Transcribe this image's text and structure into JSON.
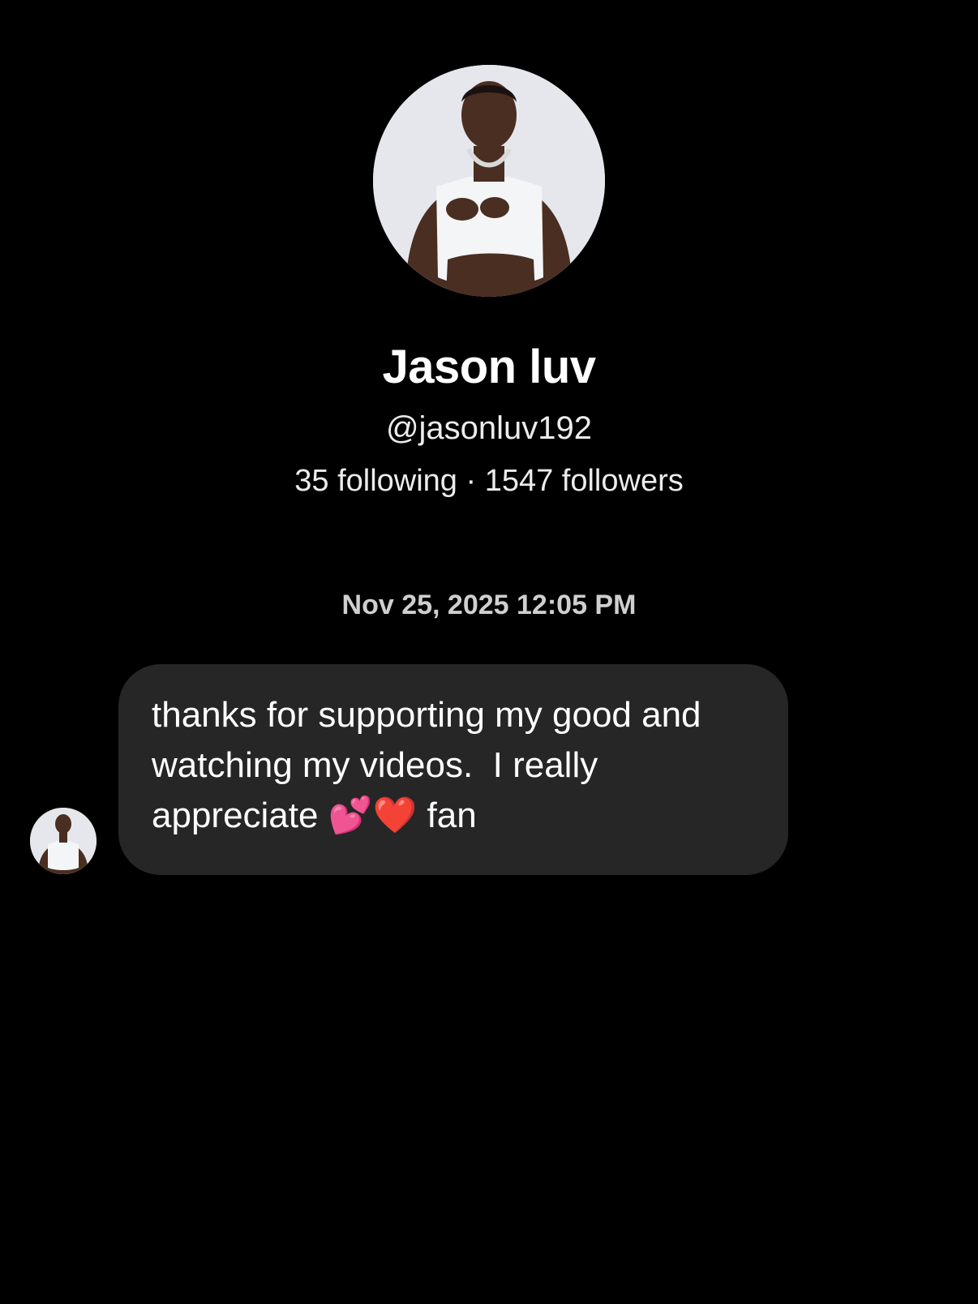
{
  "profile": {
    "display_name": "Jason luv",
    "username": "@jasonluv192",
    "stats": "35 following · 1547 followers"
  },
  "conversation": {
    "timestamp": "Nov 25, 2025 12:05 PM",
    "messages": [
      {
        "text": "thanks for supporting my good and watching my videos.  I really appreciate 💕❤️ fan"
      }
    ]
  },
  "colors": {
    "background": "#000000",
    "bubble": "#262626",
    "text": "#ffffff",
    "timestamp": "#cfcfcf"
  },
  "icons": {
    "profile_avatar": "person-photo",
    "message_avatar": "person-photo"
  }
}
